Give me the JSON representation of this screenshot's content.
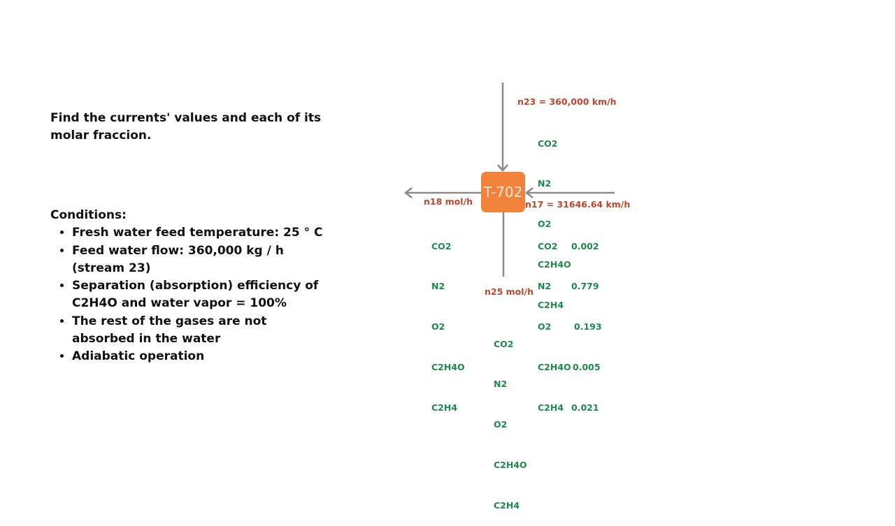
{
  "problem": {
    "statement": "Find the currents' values and each of its molar fraccion."
  },
  "conditions": {
    "title": "Conditions:",
    "items": [
      "Fresh water feed temperature: 25 ° C",
      "Feed water flow: 360,000 kg / h (stream 23)",
      "Separation (absorption) efficiency of C2H4O and water vapor = 100%",
      "The rest of the gases are not absorbed in the water",
      "Adiabatic operation"
    ]
  },
  "diagram": {
    "unit": "T-702",
    "colors": {
      "unit": "#f0823a",
      "label": "#c0462b",
      "component": "#1c8a4a",
      "arrow": "#8a8a8a"
    },
    "streams": {
      "n23": {
        "label": "n23 = 360,000 km/h",
        "components": [
          "CO2",
          "N2",
          "O2",
          "C2H4O",
          "C2H4"
        ]
      },
      "n18": {
        "label": "n18 mol/h",
        "components": [
          "CO2",
          "N2",
          "O2",
          "C2H4O",
          "C2H4"
        ]
      },
      "n17": {
        "label": "n17 = 31646.64 km/h",
        "components": [
          {
            "name": "CO2",
            "fraction": "0.002"
          },
          {
            "name": "N2",
            "fraction": "0.779"
          },
          {
            "name": "O2",
            "fraction": "0.193"
          },
          {
            "name": "C2H4O",
            "fraction": "0.005"
          },
          {
            "name": "C2H4",
            "fraction": "0.021"
          }
        ]
      },
      "n25": {
        "label": "n25 mol/h",
        "components": [
          "CO2",
          "N2",
          "O2",
          "C2H4O",
          "C2H4"
        ]
      }
    }
  }
}
